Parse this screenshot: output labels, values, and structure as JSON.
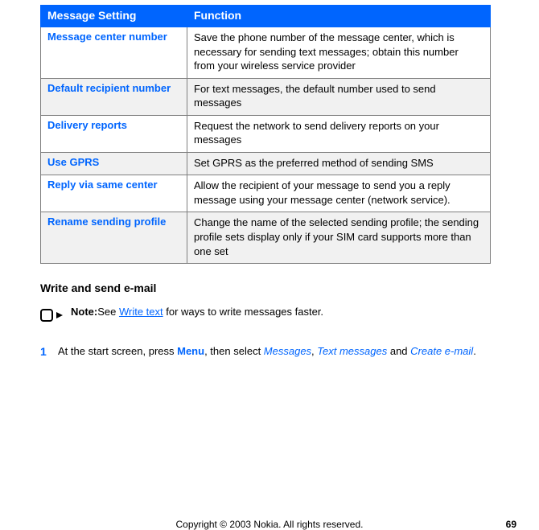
{
  "table": {
    "headers": {
      "col1": "Message Setting",
      "col2": "Function"
    },
    "rows": [
      {
        "name": "Message center number",
        "func": "Save the phone number of the message center, which is necessary for sending text messages; obtain this number\nfrom your wireless service provider",
        "alt": false
      },
      {
        "name": "Default recipient number",
        "func": "For text messages, the default number used to send messages",
        "alt": true
      },
      {
        "name": "Delivery reports",
        "func": "Request the network to send delivery reports on your messages",
        "alt": false
      },
      {
        "name": "Use GPRS",
        "func": "Set GPRS as the preferred method of sending SMS",
        "alt": true
      },
      {
        "name": "Reply via same center",
        "func": "Allow the recipient of your message to send you a reply message using your message center (network service).",
        "alt": false
      },
      {
        "name": "Rename sending profile",
        "func": "Change the name of the selected sending profile; the sending profile sets display only if your SIM card supports more than one set",
        "alt": true
      }
    ]
  },
  "section_heading": "Write and send e-mail",
  "note": {
    "label": "Note:",
    "before_link": "See ",
    "link": "Write text",
    "after_link": " for ways to write messages faster."
  },
  "step": {
    "num": "1",
    "t1": "At the start screen, press ",
    "menu": "Menu",
    "t2": ", then select ",
    "l1": "Messages",
    "t3": ", ",
    "l2": "Text messages",
    "t4": " and ",
    "l3": "Create e-mail",
    "t5": "."
  },
  "footer": {
    "copyright": "Copyright © 2003 Nokia. All rights reserved.",
    "page": "69"
  }
}
